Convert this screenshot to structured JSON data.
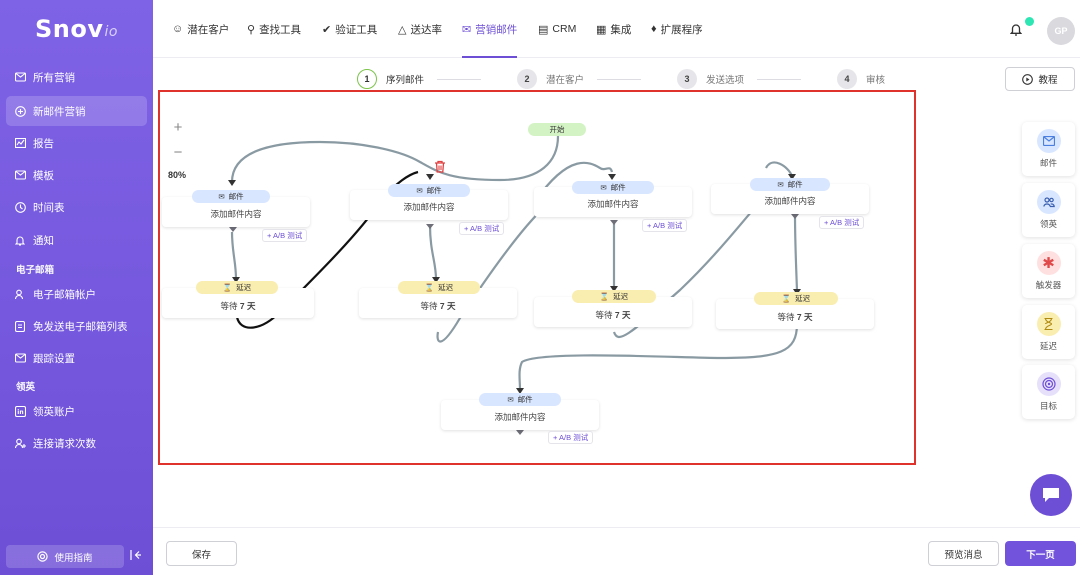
{
  "brand": {
    "name": "Snov",
    "suffix": "io"
  },
  "nav": {
    "items": [
      {
        "label": "潜在客户",
        "icon": "users-icon"
      },
      {
        "label": "查找工具",
        "icon": "search-icon"
      },
      {
        "label": "验证工具",
        "icon": "check-circle-icon"
      },
      {
        "label": "送达率",
        "icon": "flame-icon"
      },
      {
        "label": "营销邮件",
        "icon": "mail-icon",
        "active": true
      },
      {
        "label": "CRM",
        "icon": "crm-icon"
      },
      {
        "label": "集成",
        "icon": "grid-icon"
      },
      {
        "label": "扩展程序",
        "icon": "puzzle-icon"
      }
    ],
    "avatar": "GP"
  },
  "sidebar": {
    "items": [
      {
        "label": "所有营销",
        "icon": "mail-icon"
      },
      {
        "label": "新邮件营销",
        "icon": "plus-circle-icon",
        "active": true
      },
      {
        "label": "报告",
        "icon": "chart-icon"
      },
      {
        "label": "模板",
        "icon": "template-icon"
      },
      {
        "label": "时间表",
        "icon": "clock-icon"
      },
      {
        "label": "通知",
        "icon": "bell-icon"
      }
    ],
    "email_section": "电子邮箱",
    "email_items": [
      {
        "label": "电子邮箱帐户",
        "icon": "account-icon"
      },
      {
        "label": "免发送电子邮箱列表",
        "icon": "list-icon"
      },
      {
        "label": "跟踪设置",
        "icon": "tracking-icon"
      }
    ],
    "linkedin_section": "领英",
    "linkedin_items": [
      {
        "label": "领英账户",
        "icon": "linkedin-icon"
      },
      {
        "label": "连接请求次数",
        "icon": "add-user-icon"
      }
    ],
    "help": "使用指南"
  },
  "steps": [
    {
      "num": "1",
      "label": "序列邮件",
      "active": true
    },
    {
      "num": "2",
      "label": "潜在客户"
    },
    {
      "num": "3",
      "label": "发送选项"
    },
    {
      "num": "4",
      "label": "审核"
    }
  ],
  "tutorial": "教程",
  "canvas": {
    "zoom": "80%",
    "start": "开始",
    "mail_pill": "邮件",
    "mail_caption": "添加邮件内容",
    "delay_pill": "延迟",
    "delay_prefix": "等待",
    "delay_days": "7",
    "delay_unit": "天",
    "abtest": "+ A/B 测试"
  },
  "tools": [
    {
      "label": "邮件",
      "icon": "mail-icon",
      "color": "#d8e6ff"
    },
    {
      "label": "领英",
      "icon": "linkedin-users-icon",
      "color": "#d8e6ff"
    },
    {
      "label": "触发器",
      "icon": "trigger-icon",
      "color": "#ffe0e0"
    },
    {
      "label": "延迟",
      "icon": "hourglass-icon",
      "color": "#faedb0"
    },
    {
      "label": "目标",
      "icon": "target-icon",
      "color": "#e6e0fb"
    }
  ],
  "bottom": {
    "save": "保存",
    "preview": "预览消息",
    "next": "下一页"
  }
}
